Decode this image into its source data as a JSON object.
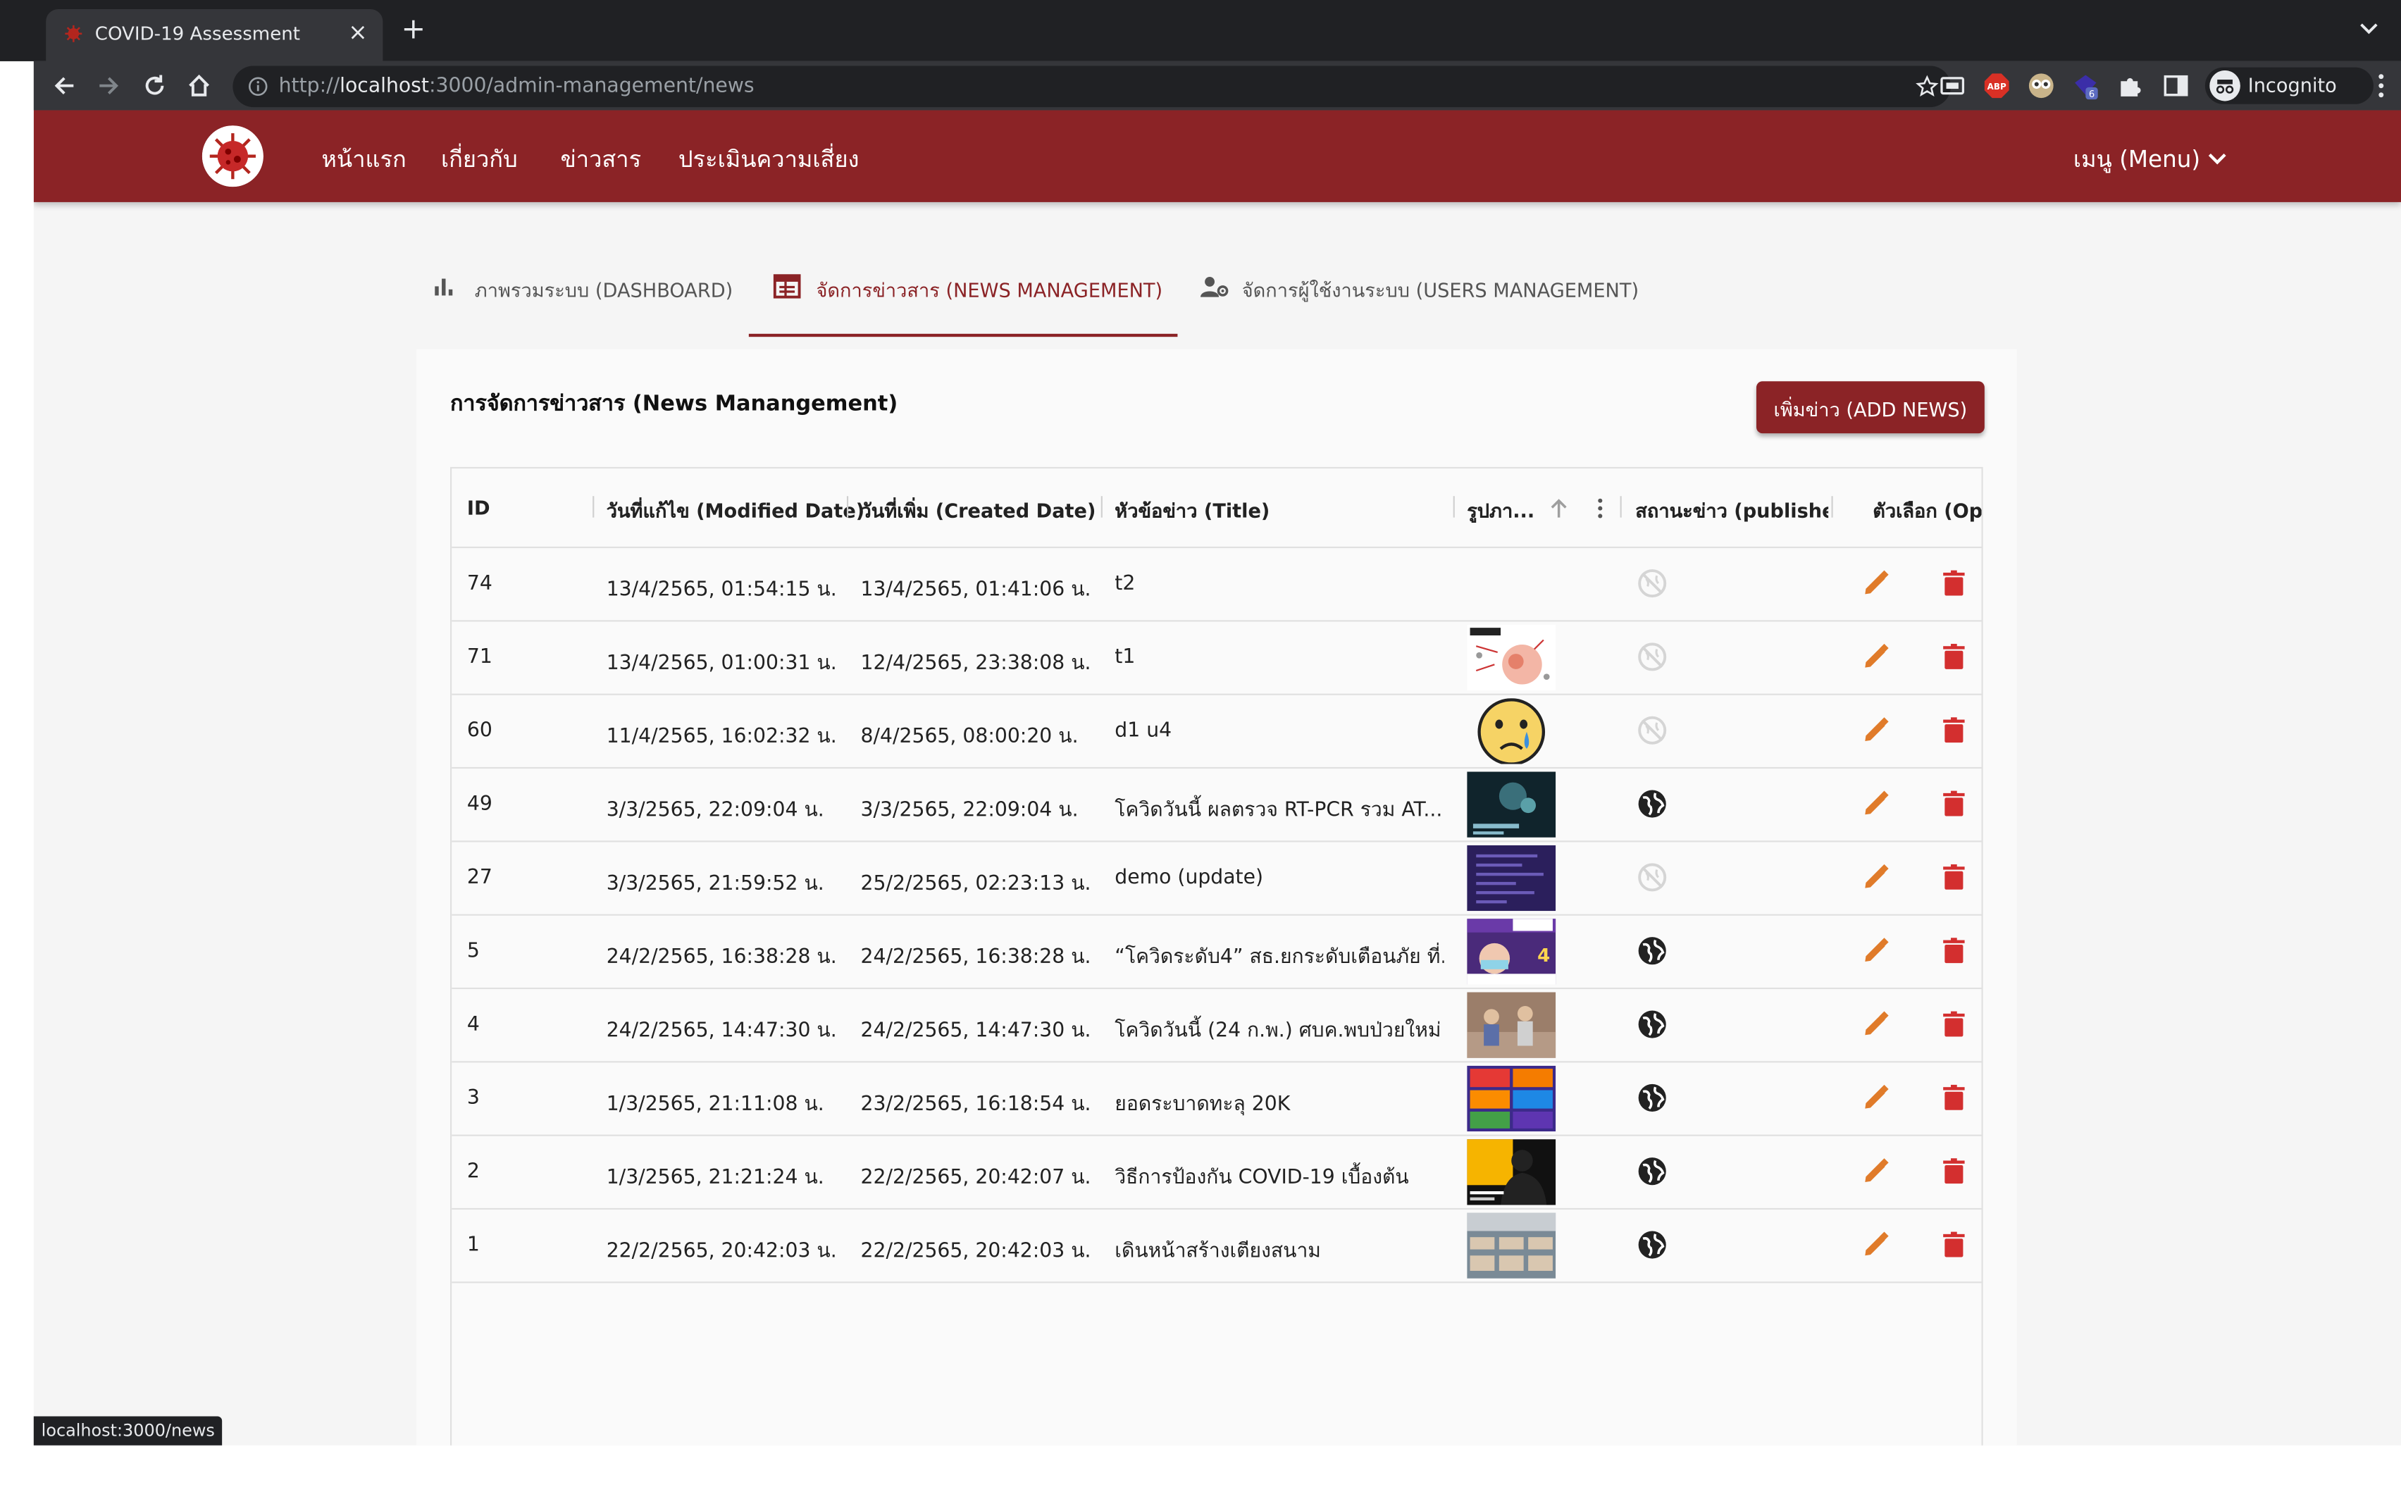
{
  "browser": {
    "tab_title": "COVID-19 Assessment",
    "url_prefix": "http://",
    "url_host": "localhost",
    "url_rest": ":3000/admin-management/news",
    "incognito_label": "Incognito",
    "extension_badge": "6",
    "status_url": "localhost:3000/news"
  },
  "header": {
    "nav": [
      "หน้าแรก",
      "เกี่ยวกับ",
      "ข่าวสาร",
      "ประเมินความเสี่ยง"
    ],
    "menu_label": "เมนู (Menu)"
  },
  "tabs": [
    {
      "label": "ภาพรวมระบบ (DASHBOARD)",
      "icon": "bar-chart-icon",
      "active": false
    },
    {
      "label": "จัดการข่าวสาร (NEWS MANAGEMENT)",
      "icon": "news-icon",
      "active": true
    },
    {
      "label": "จัดการผู้ใช้งานระบบ (USERS MANAGEMENT)",
      "icon": "user-settings-icon",
      "active": false
    }
  ],
  "card": {
    "title": "การจัดการข่าวสาร (News Manangement)",
    "add_button": "เพิ่มข่าว (ADD NEWS)"
  },
  "table": {
    "columns": [
      "ID",
      "วันที่แก้ไข (Modified Date)",
      "วันที่เพิ่ม (Created Date)",
      "หัวข้อข่าว (Title)",
      "รูปภา...",
      "สถานะข่าว (publishe...",
      "ตัวเลือก (Opti"
    ],
    "sort_column": "รูปภา...",
    "rows": [
      {
        "id": "74",
        "modified": "13/4/2565, 01:54:15 น.",
        "created": "13/4/2565, 01:41:06 น.",
        "title": "t2",
        "image": "none",
        "published": false
      },
      {
        "id": "71",
        "modified": "13/4/2565, 01:00:31 น.",
        "created": "12/4/2565, 23:38:08 น.",
        "title": "t1",
        "image": "infographic-white",
        "published": false
      },
      {
        "id": "60",
        "modified": "11/4/2565, 16:02:32 น.",
        "created": "8/4/2565, 08:00:20 น.",
        "title": "d1 u4",
        "image": "crying-emoji",
        "published": false
      },
      {
        "id": "49",
        "modified": "3/3/2565, 22:09:04 น.",
        "created": "3/3/2565, 22:09:04 น.",
        "title": "โควิดวันนี้ ผลตรวจ RT-PCR รวม AT...",
        "image": "dark-teal",
        "published": true
      },
      {
        "id": "27",
        "modified": "3/3/2565, 21:59:52 น.",
        "created": "25/2/2565, 02:23:13 น.",
        "title": "demo (update)",
        "image": "dark-purple",
        "published": false
      },
      {
        "id": "5",
        "modified": "24/2/2565, 16:38:28 น.",
        "created": "24/2/2565, 16:38:28 น.",
        "title": "“โควิดระดับ4” สธ.ยกระดับเตือนภัย ที่...",
        "image": "poster-purple",
        "published": true
      },
      {
        "id": "4",
        "modified": "24/2/2565, 14:47:30 น.",
        "created": "24/2/2565, 14:47:30 น.",
        "title": "โควิดวันนี้ (24 ก.พ.) ศบค.พบป่วยใหม่ ...",
        "image": "photo-people",
        "published": true
      },
      {
        "id": "3",
        "modified": "1/3/2565, 21:11:08 น.",
        "created": "23/2/2565, 16:18:54 น.",
        "title": "ยอดระบาดทะลุ 20K",
        "image": "stats-grid",
        "published": true
      },
      {
        "id": "2",
        "modified": "1/3/2565, 21:21:24 น.",
        "created": "22/2/2565, 20:42:07 น.",
        "title": "วิธีการป้องกัน COVID-19 เบื้องต้น",
        "image": "silhouette-yellow",
        "published": true
      },
      {
        "id": "1",
        "modified": "22/2/2565, 20:42:03 น.",
        "created": "22/2/2565, 20:42:03 น.",
        "title": "เดินหน้าสร้างเตียงสนาม",
        "image": "beds-photo",
        "published": true
      }
    ]
  },
  "colors": {
    "brand": "#8b2326",
    "edit_icon": "#e07b2a",
    "delete_icon": "#d32f2f",
    "chrome_dark": "#202124"
  }
}
